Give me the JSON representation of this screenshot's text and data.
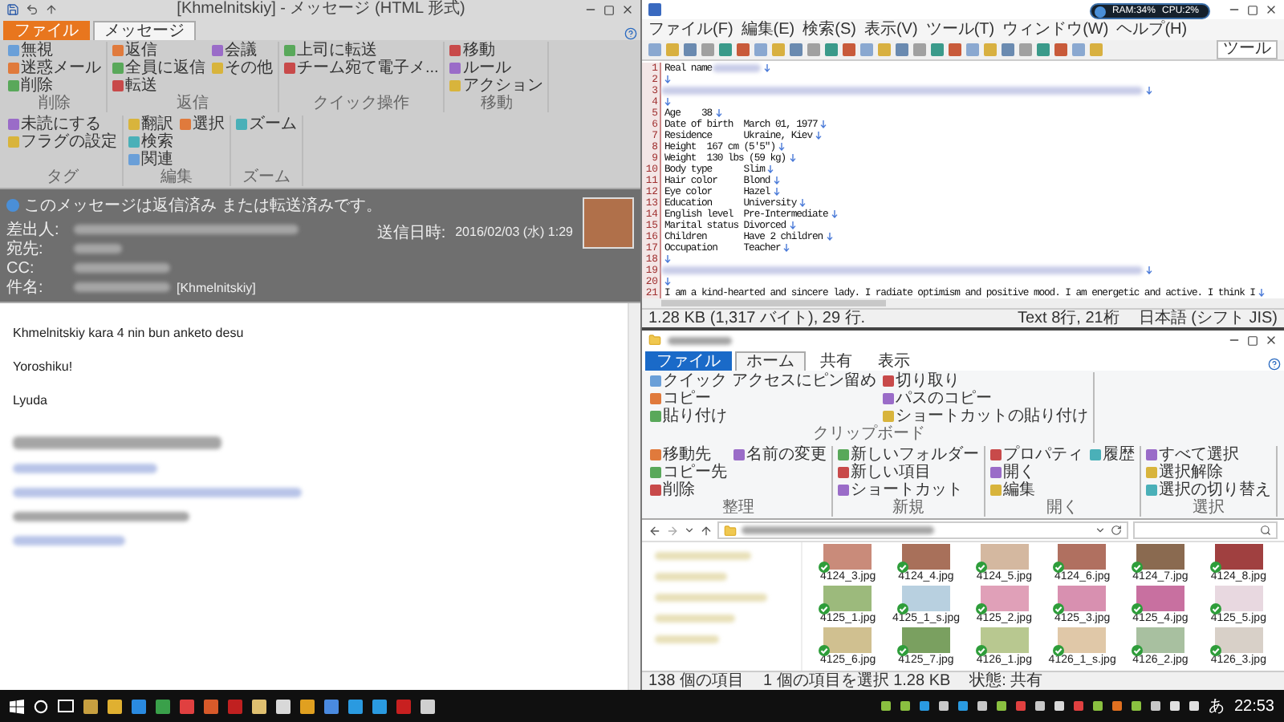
{
  "outlook": {
    "title": "[Khmelnitskiy] - メッセージ (HTML 形式)",
    "tabs": [
      {
        "label": "ファイル",
        "kind": "file",
        "selected": false
      },
      {
        "label": "メッセージ",
        "kind": "tab",
        "selected": true
      }
    ],
    "ribbon": [
      {
        "label": "削除",
        "items": [
          "無視",
          "迷惑メール",
          "削除"
        ]
      },
      {
        "label": "返信",
        "items": [
          "返信",
          "全員に返信",
          "転送",
          "会議",
          "その他"
        ]
      },
      {
        "label": "クイック操作",
        "items": [
          "上司に転送",
          "チーム宛て電子メ..."
        ]
      },
      {
        "label": "移動",
        "items": [
          "移動",
          "ルール",
          "アクション"
        ]
      },
      {
        "label": "タグ",
        "items": [
          "未読にする",
          "フラグの設定"
        ]
      },
      {
        "label": "編集",
        "items": [
          "翻訳",
          "検索",
          "関連",
          "選択"
        ]
      },
      {
        "label": "ズーム",
        "items": [
          "ズーム"
        ]
      }
    ],
    "info": "このメッセージは返信済み または転送済みです。",
    "fields": [
      {
        "label": "差出人:"
      },
      {
        "label": "宛先:"
      },
      {
        "label": "CC:"
      },
      {
        "label": "件名:",
        "value": "[Khmelnitskiy]"
      }
    ],
    "sent": {
      "label": "送信日時:",
      "value": "2016/02/03 (水) 1:29"
    },
    "body": [
      "Khmelnitskiy kara 4 nin bun anketo desu",
      "Yoroshiku!",
      "Lyuda"
    ]
  },
  "editor": {
    "menu": [
      "ファイル(F)",
      "編集(E)",
      "検索(S)",
      "表示(V)",
      "ツール(T)",
      "ウィンドウ(W)",
      "ヘルプ(H)"
    ],
    "toolbar_label": "ツール",
    "lines": [
      {
        "number": "1",
        "text": "Real name",
        "redacted": true
      },
      {
        "number": "2",
        "redacted": false
      },
      {
        "number": "3",
        "redacted": true
      },
      {
        "number": "4",
        "redacted": false
      },
      {
        "number": "5",
        "text": "Age    38",
        "redacted": false
      },
      {
        "number": "6",
        "text": "Date of birth  March 01, 1977",
        "redacted": false
      },
      {
        "number": "7",
        "text": "Residence      Ukraine, Kiev",
        "redacted": false
      },
      {
        "number": "8",
        "text": "Height  167 cm (5'5\")",
        "redacted": false
      },
      {
        "number": "9",
        "text": "Weight  130 lbs (59 kg)",
        "redacted": false
      },
      {
        "number": "10",
        "text": "Body type      Slim",
        "redacted": false
      },
      {
        "number": "11",
        "text": "Hair color     Blond",
        "redacted": false
      },
      {
        "number": "12",
        "text": "Eye color      Hazel",
        "redacted": false
      },
      {
        "number": "13",
        "text": "Education      University",
        "redacted": false
      },
      {
        "number": "14",
        "text": "English level  Pre-Intermediate",
        "redacted": false
      },
      {
        "number": "15",
        "text": "Marital status Divorced",
        "redacted": false
      },
      {
        "number": "16",
        "text": "Children       Have 2 children",
        "redacted": false
      },
      {
        "number": "17",
        "text": "Occupation     Teacher",
        "redacted": false
      },
      {
        "number": "18",
        "redacted": false
      },
      {
        "number": "19",
        "redacted": true
      },
      {
        "number": "20",
        "redacted": false
      },
      {
        "number": "21",
        "text": "I am a kind-hearted and sincere lady. I radiate optimism and positive mood. I am energetic and active. I think I",
        "redacted": false
      }
    ],
    "status": [
      "1.28 KB (1,317 バイト), 29 行.",
      "Text 8行, 21桁",
      "日本語 (シフト JIS)"
    ]
  },
  "monitor": {
    "ram": "RAM:34%",
    "cpu": "CPU:2%"
  },
  "explorer": {
    "tabs": [
      {
        "label": "ファイル",
        "kind": "file",
        "selected": false
      },
      {
        "label": "ホーム",
        "kind": "tab",
        "selected": true
      },
      {
        "label": "共有",
        "kind": "tab",
        "selected": false
      },
      {
        "label": "表示",
        "kind": "tab",
        "selected": false
      }
    ],
    "ribbon": [
      {
        "label": "クリップボード",
        "items": [
          "クイック アクセスにピン留め",
          "コピー",
          "貼り付け",
          "切り取り",
          "パスのコピー",
          "ショートカットの貼り付け"
        ]
      },
      {
        "label": "整理",
        "items": [
          "移動先",
          "コピー先",
          "削除",
          "名前の変更"
        ]
      },
      {
        "label": "新規",
        "items": [
          "新しいフォルダー",
          "新しい項目",
          "ショートカット"
        ]
      },
      {
        "label": "開く",
        "items": [
          "プロパティ",
          "開く",
          "編集",
          "履歴"
        ]
      },
      {
        "label": "選択",
        "items": [
          "すべて選択",
          "選択解除",
          "選択の切り替え"
        ]
      }
    ],
    "files": [
      {
        "name": "4124_3.jpg"
      },
      {
        "name": "4124_4.jpg"
      },
      {
        "name": "4124_5.jpg"
      },
      {
        "name": "4124_6.jpg"
      },
      {
        "name": "4124_7.jpg"
      },
      {
        "name": "4124_8.jpg"
      },
      {
        "name": "4125_1.jpg"
      },
      {
        "name": "4125_1_s.jpg"
      },
      {
        "name": "4125_2.jpg"
      },
      {
        "name": "4125_3.jpg"
      },
      {
        "name": "4125_4.jpg"
      },
      {
        "name": "4125_5.jpg"
      },
      {
        "name": "4125_6.jpg"
      },
      {
        "name": "4125_7.jpg"
      },
      {
        "name": "4126_1.jpg"
      },
      {
        "name": "4126_1_s.jpg"
      },
      {
        "name": "4126_2.jpg"
      },
      {
        "name": "4126_3.jpg"
      }
    ],
    "status": [
      "138 個の項目",
      "1 個の項目を選択 1.28 KB",
      "状態: 共有"
    ]
  },
  "taskbar": {
    "ime": "あ",
    "time": "22:53"
  }
}
